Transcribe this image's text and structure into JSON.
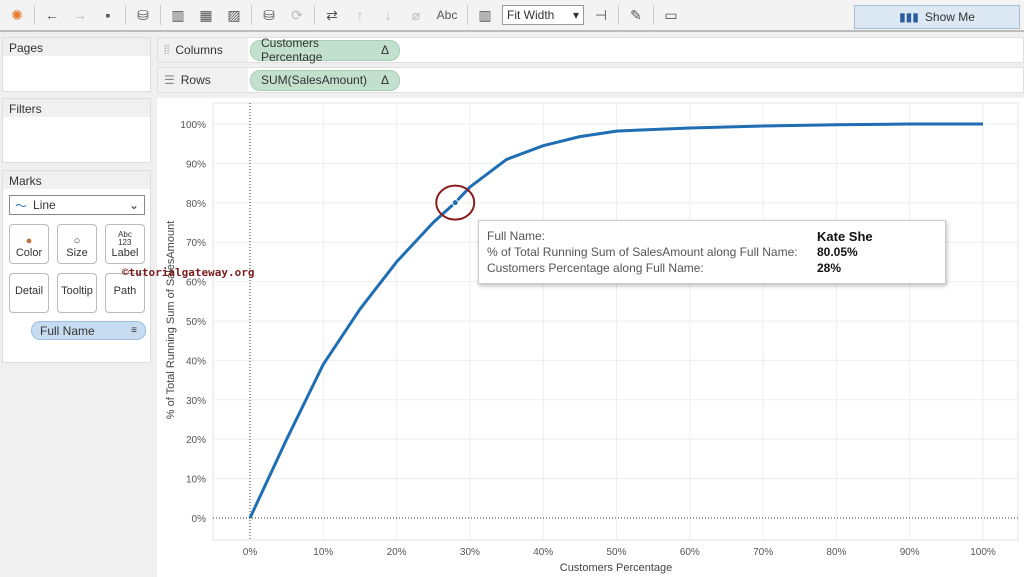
{
  "toolbar": {
    "fit_label": "Fit Width",
    "abc_label": "Abc",
    "show_me_label": "Show Me"
  },
  "pages": {
    "title": "Pages"
  },
  "filters": {
    "title": "Filters"
  },
  "marks": {
    "title": "Marks",
    "type": "Line",
    "buttons": [
      "Color",
      "Size",
      "Label",
      "Detail",
      "Tooltip",
      "Path"
    ],
    "label_icon_text": "Abc\n123",
    "pill": "Full Name"
  },
  "shelves": {
    "columns_label": "Columns",
    "columns_pill": "Customers Percentage",
    "rows_label": "Rows",
    "rows_pill": "SUM(SalesAmount)",
    "delta": "Δ"
  },
  "watermark": "©tutorialgateway.org",
  "tooltip": {
    "rows": [
      {
        "key": "Full Name:",
        "value": "Kate She"
      },
      {
        "key": "% of Total Running Sum of SalesAmount along Full Name:",
        "value": "80.05%"
      },
      {
        "key": "Customers Percentage along Full Name:",
        "value": "28%"
      }
    ]
  },
  "chart_data": {
    "type": "line",
    "xlabel": "Customers Percentage",
    "ylabel": "% of Total Running Sum of SalesAmount",
    "xlim": [
      0,
      100
    ],
    "ylim": [
      0,
      100
    ],
    "x_ticks": [
      "0%",
      "10%",
      "20%",
      "30%",
      "40%",
      "50%",
      "60%",
      "70%",
      "80%",
      "90%",
      "100%"
    ],
    "y_ticks": [
      "0%",
      "10%",
      "20%",
      "30%",
      "40%",
      "50%",
      "60%",
      "70%",
      "80%",
      "90%",
      "100%"
    ],
    "grid": true,
    "color": "#1f6eb4",
    "x": [
      0,
      2,
      5,
      10,
      15,
      20,
      25,
      28,
      30,
      35,
      40,
      45,
      50,
      60,
      70,
      80,
      90,
      100
    ],
    "y": [
      0,
      8,
      20,
      39,
      53,
      65,
      75,
      80.05,
      84,
      91,
      94.5,
      96.8,
      98.2,
      99,
      99.5,
      99.8,
      100,
      100
    ],
    "highlight": {
      "x": 28,
      "y": 80.05
    }
  }
}
